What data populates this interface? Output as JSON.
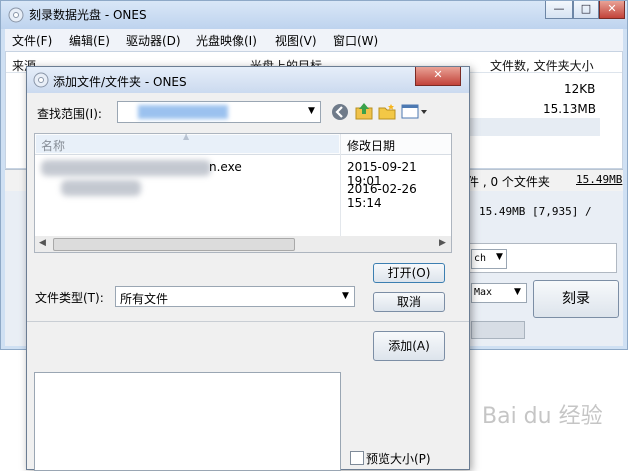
{
  "main_window": {
    "title": "刻录数据光盘 - ONES",
    "caption_buttons": {
      "minimize": "—",
      "maximize": "□",
      "close": "✕"
    },
    "menu": [
      "文件(F)",
      "编辑(E)",
      "驱动器(D)",
      "光盘映像(I)",
      "视图(V)",
      "窗口(W)"
    ],
    "columns": {
      "source": "来源",
      "target": "光盘上的目标",
      "count": "文件数, 文件夹大小"
    },
    "rows": [
      {
        "size": "12KB"
      },
      {
        "size": "15.13MB"
      }
    ],
    "status_text": "件 , 0 个文件夹",
    "status_size": "15.49MB",
    "summary_text": "15.49MB [7,935] /",
    "select1_value": "ch",
    "select2_value": "Max",
    "burn_button": "刻录"
  },
  "dialog": {
    "title": "添加文件/文件夹 - ONES",
    "close": "✕",
    "lookin_label": "查找范围(I):",
    "columns": {
      "name": "名称",
      "modified": "修改日期"
    },
    "files": [
      {
        "name": "n.exe",
        "date": "2015-09-21 19:01"
      },
      {
        "name": "",
        "date": "2016-02-26 15:14"
      }
    ],
    "filetype_label": "文件类型(T):",
    "filetype_value": "所有文件",
    "open_button": "打开(O)",
    "cancel_button": "取消",
    "add_button": "添加(A)",
    "preview_label": "预览大小(P)"
  },
  "watermark": {
    "text": "Bai du 经验"
  },
  "colors": {
    "window_frame": "#cfe0f3",
    "close_red": "#c2433a",
    "selection_blue": "#4a90e2"
  }
}
